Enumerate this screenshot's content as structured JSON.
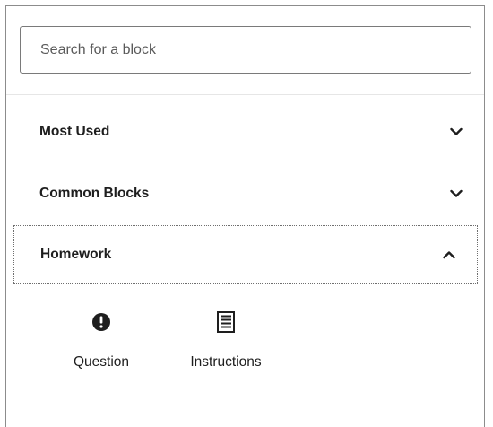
{
  "search": {
    "placeholder": "Search for a block",
    "value": ""
  },
  "categories": [
    {
      "label": "Most Used",
      "expanded": false,
      "icon": "chevron-down-icon"
    },
    {
      "label": "Common Blocks",
      "expanded": false,
      "icon": "chevron-down-icon"
    },
    {
      "label": "Homework",
      "expanded": true,
      "icon": "chevron-up-icon"
    }
  ],
  "homework_blocks": [
    {
      "label": "Question",
      "icon": "exclamation-circle-icon"
    },
    {
      "label": "Instructions",
      "icon": "list-document-icon"
    }
  ],
  "colors": {
    "text": "#1e1e1e",
    "border": "#7a7a7a"
  }
}
